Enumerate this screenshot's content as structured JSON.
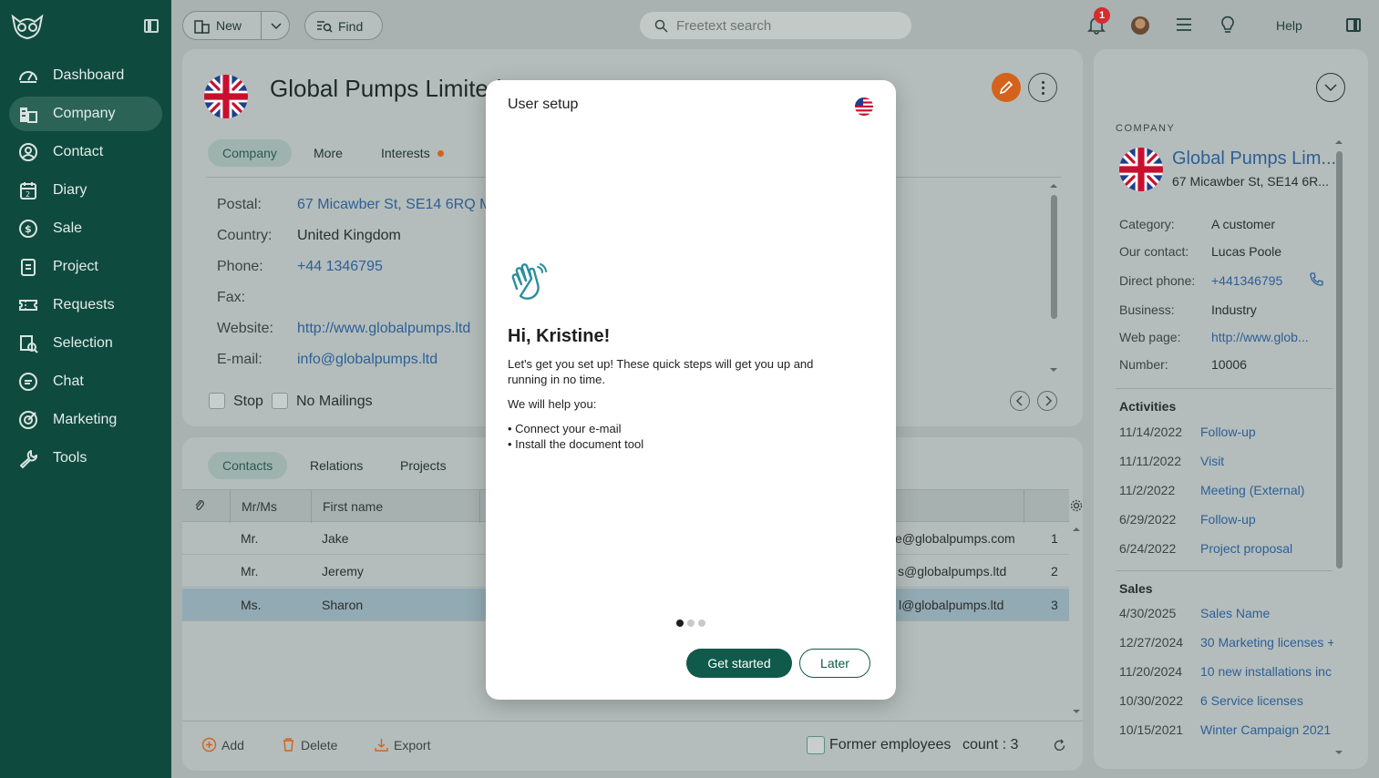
{
  "sidebar": {
    "items": [
      {
        "label": "Dashboard",
        "icon": "gauge-icon"
      },
      {
        "label": "Company",
        "icon": "building-icon",
        "active": true
      },
      {
        "label": "Contact",
        "icon": "person-icon"
      },
      {
        "label": "Diary",
        "icon": "calendar-icon"
      },
      {
        "label": "Sale",
        "icon": "dollar-icon"
      },
      {
        "label": "Project",
        "icon": "clipboard-icon"
      },
      {
        "label": "Requests",
        "icon": "ticket-icon"
      },
      {
        "label": "Selection",
        "icon": "selection-icon"
      },
      {
        "label": "Chat",
        "icon": "chat-icon"
      },
      {
        "label": "Marketing",
        "icon": "target-icon"
      },
      {
        "label": "Tools",
        "icon": "wrench-icon"
      }
    ]
  },
  "topbar": {
    "new_label": "New",
    "find_label": "Find",
    "search_placeholder": "Freetext search",
    "notification_count": "1",
    "help_label": "Help"
  },
  "company": {
    "title": "Global Pumps Limited",
    "tabs": [
      "Company",
      "More",
      "Interests"
    ],
    "fields": [
      {
        "label": "Postal:",
        "value": "67 Micawber St, SE14 6RQ M",
        "link": true
      },
      {
        "label": "Country:",
        "value": "United Kingdom",
        "link": false
      },
      {
        "label": "Phone:",
        "value": "+44 1346795",
        "link": true
      },
      {
        "label": "Fax:",
        "value": "",
        "link": false
      },
      {
        "label": "Website:",
        "value": "http://www.globalpumps.ltd",
        "link": true
      },
      {
        "label": "E-mail:",
        "value": "info@globalpumps.ltd",
        "link": true
      }
    ],
    "stop_label": "Stop",
    "no_mailings_label": "No Mailings"
  },
  "contacts": {
    "tabs": [
      "Contacts",
      "Relations",
      "Projects"
    ],
    "columns": [
      "Mr/Ms",
      "First name"
    ],
    "rows": [
      {
        "title": "Mr.",
        "first": "Jake",
        "email": "e@globalpumps.com",
        "num": "1"
      },
      {
        "title": "Mr.",
        "first": "Jeremy",
        "email": "s@globalpumps.ltd",
        "num": "2"
      },
      {
        "title": "Ms.",
        "first": "Sharon",
        "email": "l@globalpumps.ltd",
        "num": "3",
        "selected": true
      }
    ],
    "add_label": "Add",
    "delete_label": "Delete",
    "export_label": "Export",
    "former_label": "Former employees",
    "count_label": "count : 3"
  },
  "right_panel": {
    "section": "COMPANY",
    "name": "Global Pumps Lim...",
    "address": "67 Micawber St, SE14 6R...",
    "fields": [
      {
        "label": "Category:",
        "value": "A customer",
        "link": false
      },
      {
        "label": "Our contact:",
        "value": "Lucas Poole",
        "link": false
      },
      {
        "label": "Direct phone:",
        "value": "+441346795",
        "link": true
      },
      {
        "label": "Business:",
        "value": "Industry",
        "link": false
      },
      {
        "label": "Web page:",
        "value": "http://www.glob...",
        "link": true
      },
      {
        "label": "Number:",
        "value": "10006",
        "link": false
      }
    ],
    "activities_heading": "Activities",
    "activities": [
      {
        "date": "11/14/2022",
        "text": "Follow-up"
      },
      {
        "date": "11/11/2022",
        "text": "Visit"
      },
      {
        "date": "11/2/2022",
        "text": "Meeting (External)"
      },
      {
        "date": "6/29/2022",
        "text": "Follow-up"
      },
      {
        "date": "6/24/2022",
        "text": "Project proposal"
      }
    ],
    "sales_heading": "Sales",
    "sales": [
      {
        "date": "4/30/2025",
        "text": "Sales Name"
      },
      {
        "date": "12/27/2024",
        "text": "30 Marketing licenses +"
      },
      {
        "date": "11/20/2024",
        "text": "10 new installations inc"
      },
      {
        "date": "10/30/2022",
        "text": "6 Service licenses"
      },
      {
        "date": "10/15/2021",
        "text": "Winter Campaign 2021"
      }
    ]
  },
  "modal": {
    "title": "User setup",
    "greeting": "Hi, Kristine!",
    "intro": "Let's get you set up! These quick steps will get you up and running in no time.",
    "help_intro": "We will help you:",
    "steps": [
      "• Connect your e-mail",
      "• Install the document tool"
    ],
    "get_started_label": "Get started",
    "later_label": "Later"
  },
  "colors": {
    "sidebar_bg": "#0f4a3e",
    "accent": "#0f5a4a",
    "link": "#2d5f98",
    "edit_orange": "#d4621d",
    "badge_red": "#d32d2d"
  }
}
